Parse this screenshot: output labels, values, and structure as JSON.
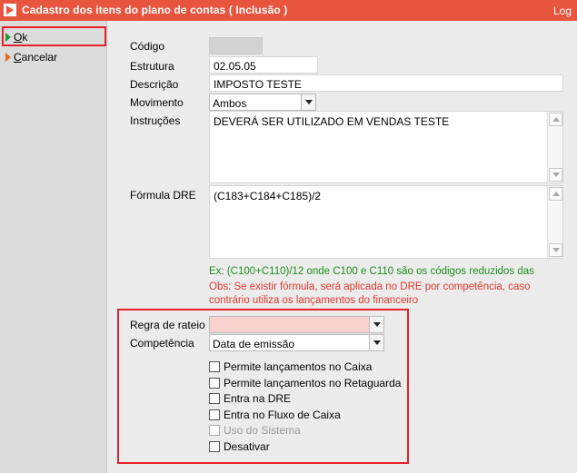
{
  "window": {
    "title": "Cadastro dos itens do plano de contas ( Inclusão )",
    "log_label": "Log"
  },
  "sidebar": {
    "ok": {
      "accel": "O",
      "rest": "k"
    },
    "cancel": {
      "accel": "C",
      "rest": "ancelar"
    }
  },
  "form": {
    "codigo": {
      "label": "Código",
      "value": ""
    },
    "estrutura": {
      "label": "Estrutura",
      "value": "02.05.05"
    },
    "descricao": {
      "label": "Descrição",
      "value": "IMPOSTO TESTE"
    },
    "movimento": {
      "label": "Movimento",
      "value": "Ambos"
    },
    "instrucoes": {
      "label": "Instruções",
      "value": "DEVERÁ SER UTILIZADO EM VENDAS TESTE"
    },
    "formula": {
      "label": "Fórmula DRE",
      "value": "(C183+C184+C185)/2"
    },
    "hint_example": "Ex:  (C100+C110)/12    onde   C100 e C110 são os códigos  reduzidos das",
    "hint_obs_1": "Obs: Se existir fórmula,  será aplicada  no DRE  por  competência,  caso",
    "hint_obs_2": "contrário utiliza os lançamentos do financeiro",
    "regra_rateio": {
      "label": "Regra de rateio",
      "value": ""
    },
    "competencia": {
      "label": "Competência",
      "value": "Data de emissão"
    }
  },
  "checkboxes": [
    {
      "label": "Permite lançamentos no Caixa",
      "checked": false,
      "enabled": true
    },
    {
      "label": "Permite lançamentos no Retaguarda",
      "checked": false,
      "enabled": true
    },
    {
      "label": "Entra na DRE",
      "checked": false,
      "enabled": true
    },
    {
      "label": "Entra no Fluxo de Caixa",
      "checked": false,
      "enabled": true
    },
    {
      "label": "Uso do Sistema",
      "checked": false,
      "enabled": false
    },
    {
      "label": "Desativar",
      "checked": false,
      "enabled": true
    }
  ],
  "colors": {
    "titlebar": "#e8553f",
    "highlight": "#e8202a",
    "hint_green": "#1a8f1a",
    "hint_red": "#e3382e"
  }
}
